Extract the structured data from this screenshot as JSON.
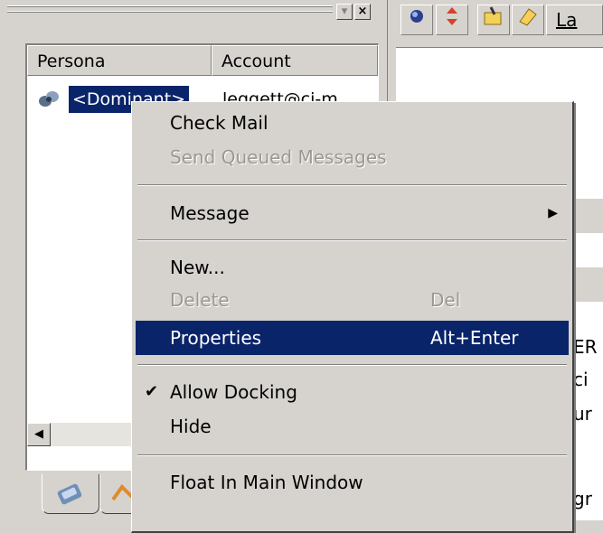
{
  "persona_panel": {
    "columns": [
      "Persona",
      "Account"
    ],
    "rows": [
      {
        "persona": "<Dominant>",
        "account": "leggett@ci-m"
      }
    ],
    "close_glyph": "×",
    "restore_glyph": "▾",
    "scroll_left_glyph": "◀"
  },
  "toolbar": {
    "partial_label": "La",
    "icons": [
      "sphere-icon",
      "priority-arrows-icon",
      "mail-label-icon",
      "tag-icon"
    ]
  },
  "right_pane_fragments": [
    "ER",
    "ci",
    "ur",
    "gr"
  ],
  "context_menu": {
    "items": [
      {
        "label": "Check Mail",
        "enabled": true
      },
      {
        "label": "Send Queued Messages",
        "enabled": false
      },
      {
        "label": "Message",
        "enabled": true,
        "submenu": true
      },
      {
        "label": "New...",
        "enabled": true
      },
      {
        "label": "Delete",
        "shortcut": "Del",
        "enabled": false
      },
      {
        "label": "Properties",
        "shortcut": "Alt+Enter",
        "enabled": true,
        "highlighted": true
      },
      {
        "label": "Allow Docking",
        "enabled": true,
        "checked": true
      },
      {
        "label": "Hide",
        "enabled": true
      },
      {
        "label": "Float In Main Window",
        "enabled": true
      }
    ],
    "check_glyph": "✔",
    "submenu_glyph": "▶"
  },
  "colors": {
    "face": "#d6d3ce",
    "highlight": "#0a246a",
    "disabled_text": "#9a9894"
  }
}
